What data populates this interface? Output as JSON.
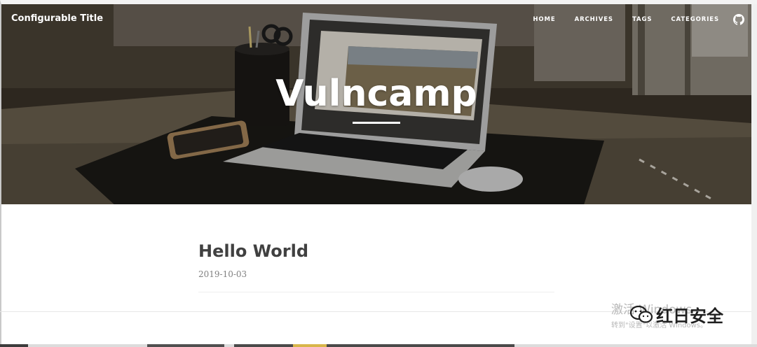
{
  "nav": {
    "brand": "Configurable Title",
    "items": [
      {
        "label": "HOME"
      },
      {
        "label": "ARCHIVES"
      },
      {
        "label": "TAGS"
      },
      {
        "label": "CATEGORIES"
      }
    ],
    "github_icon": "github-icon"
  },
  "hero": {
    "title": "Vulncamp",
    "image": "desk-laptop-photo"
  },
  "post": {
    "title": "Hello World",
    "date": "2019-10-03"
  },
  "watermark": {
    "line1": "激活 Windows",
    "line2": "转到\"设置\"以激活 Windows。"
  },
  "stamp": {
    "text": "红日安全",
    "icon": "wechat-icon"
  },
  "colors": {
    "hero_bg": "#2a241c",
    "title_text": "#404040",
    "meta_text": "#808080"
  }
}
